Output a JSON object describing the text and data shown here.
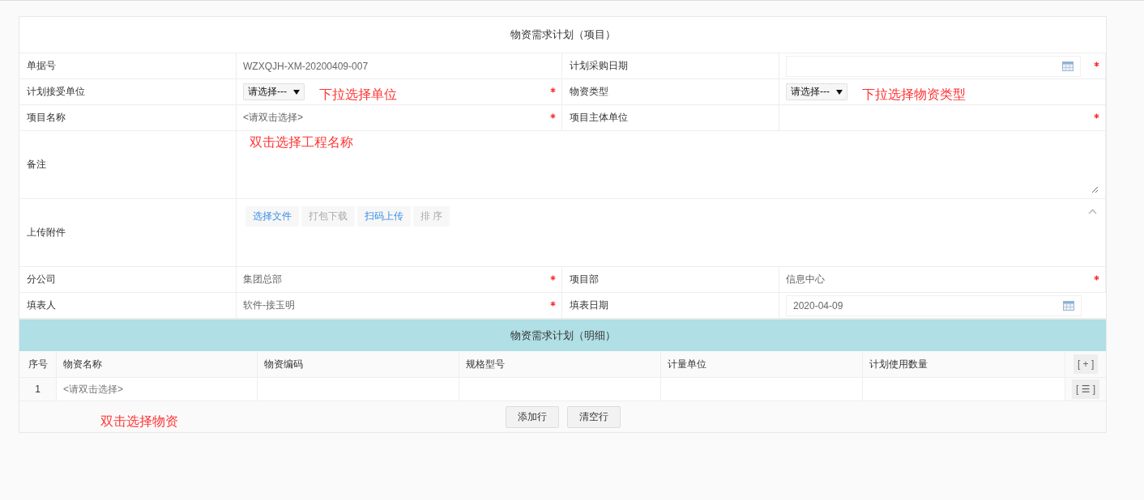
{
  "form": {
    "title": "物资需求计划（项目）",
    "rows": [
      {
        "kind": "pair",
        "cells": [
          {
            "label": "单据号",
            "kind": "text",
            "value": "WZXQJH-XM-20200409-007",
            "required": false
          },
          {
            "label": "计划采购日期",
            "kind": "date",
            "required": true
          }
        ]
      },
      {
        "kind": "pair",
        "cells": [
          {
            "label": "计划接受单位",
            "kind": "select",
            "value": "请选择---",
            "note": "下拉选择单位",
            "required": true
          },
          {
            "label": "物资类型",
            "kind": "select",
            "value": "请选择---",
            "note": "下拉选择物资类型",
            "required": false
          }
        ]
      },
      {
        "kind": "pair",
        "cells": [
          {
            "label": "项目名称",
            "kind": "picker",
            "placeholder": "<请双击选择>",
            "required": true
          },
          {
            "label": "项目主体单位",
            "kind": "text",
            "required": true
          }
        ]
      },
      {
        "kind": "full",
        "label": "备注",
        "field": {
          "kind": "textarea",
          "note": "双击选择工程名称"
        }
      },
      {
        "kind": "full",
        "label": "上传附件",
        "field": {
          "kind": "upload",
          "buttons": [
            {
              "label": "选择文件",
              "disabled": false
            },
            {
              "label": "打包下载",
              "disabled": true
            },
            {
              "label": "扫码上传",
              "disabled": false
            },
            {
              "label": "排 序",
              "disabled": true
            }
          ]
        }
      },
      {
        "kind": "pair",
        "cells": [
          {
            "label": "分公司",
            "kind": "text",
            "value": "集团总部",
            "required": true
          },
          {
            "label": "项目部",
            "kind": "text",
            "value": "信息中心",
            "required": true
          }
        ]
      },
      {
        "kind": "pair",
        "cells": [
          {
            "label": "填表人",
            "kind": "text",
            "value": "软件-接玉明",
            "required": true
          },
          {
            "label": "填表日期",
            "kind": "date",
            "value": "2020-04-09",
            "required": false
          }
        ]
      }
    ]
  },
  "detail": {
    "title": "物资需求计划（明细）",
    "columns": [
      "序号",
      "物资名称",
      "物资编码",
      "规格型号",
      "计量单位",
      "计划使用数量"
    ],
    "add_symbol": "[ + ]",
    "rows": [
      {
        "index": "1",
        "placeholder": "<请双击选择>",
        "menu_symbol": "[ ☰ ]"
      }
    ],
    "note": "双击选择物资",
    "buttons": [
      "添加行",
      "清空行"
    ]
  }
}
